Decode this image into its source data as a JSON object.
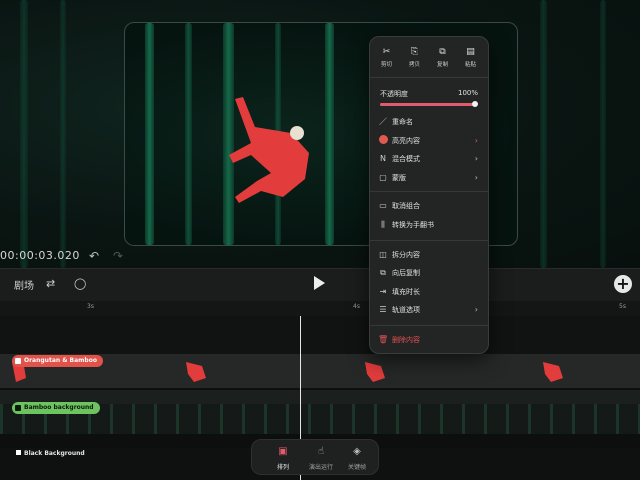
{
  "stage": {
    "timecode": "00:00:03.020",
    "undo_icon": "undo-icon",
    "redo_icon": "redo-icon"
  },
  "toolbar": {
    "scene_label": "剧场",
    "add_label": "+"
  },
  "ruler": {
    "ticks": [
      "3s",
      "4s",
      "5s"
    ]
  },
  "tracks": {
    "orangutan": "Orangutan & Bamboo",
    "bamboo_bg": "Bamboo background",
    "black_bg": "Black Background",
    "orangutan_color": "#e0524a",
    "bamboo_color": "#6cc35f"
  },
  "bottom_nav": {
    "items": [
      "排列",
      "演出运行",
      "关键帧"
    ]
  },
  "menu": {
    "quick_actions": [
      "剪切",
      "拷贝",
      "复制",
      "粘贴"
    ],
    "opacity_label": "不透明度",
    "opacity_value": "100%",
    "opacity_level": 1.0,
    "items": {
      "rename": "重命名",
      "highlight": "高亮内容",
      "blend": "混合模式",
      "mask": "蒙版",
      "ungroup": "取消组合",
      "flipbook": "转换为手翻书",
      "split": "拆分内容",
      "copy_back": "向后复制",
      "fill_duration": "填充时长",
      "track_options": "轨道选项",
      "delete": "删除内容"
    },
    "highlight_color": "#e05b4f",
    "danger_color": "#e05353"
  }
}
